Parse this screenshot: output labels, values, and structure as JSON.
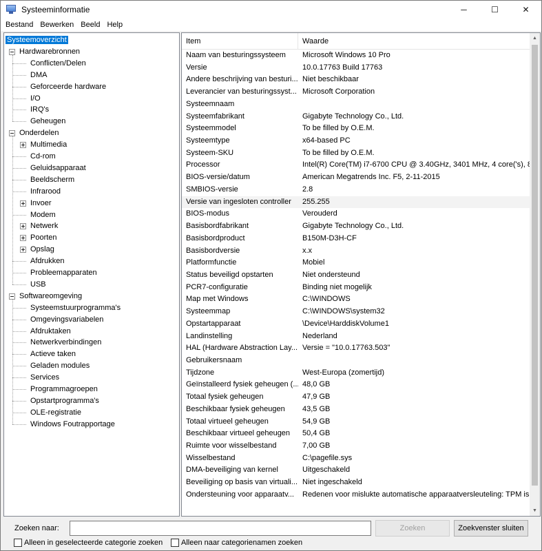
{
  "window": {
    "title": "Systeeminformatie",
    "controls": [
      "─",
      "☐",
      "✕"
    ]
  },
  "menu": [
    "Bestand",
    "Bewerken",
    "Beeld",
    "Help"
  ],
  "tree": [
    {
      "label": "Systeemoverzicht",
      "level": 0,
      "expander": "none",
      "selected": true
    },
    {
      "label": "Hardwarebronnen",
      "level": 0,
      "expander": "minus"
    },
    {
      "label": "Conflicten/Delen",
      "level": 1,
      "expander": "none"
    },
    {
      "label": "DMA",
      "level": 1,
      "expander": "none"
    },
    {
      "label": "Geforceerde hardware",
      "level": 1,
      "expander": "none"
    },
    {
      "label": "I/O",
      "level": 1,
      "expander": "none"
    },
    {
      "label": "IRQ's",
      "level": 1,
      "expander": "none"
    },
    {
      "label": "Geheugen",
      "level": 1,
      "expander": "none"
    },
    {
      "label": "Onderdelen",
      "level": 0,
      "expander": "minus"
    },
    {
      "label": "Multimedia",
      "level": 1,
      "expander": "plus"
    },
    {
      "label": "Cd-rom",
      "level": 1,
      "expander": "none"
    },
    {
      "label": "Geluidsapparaat",
      "level": 1,
      "expander": "none"
    },
    {
      "label": "Beeldscherm",
      "level": 1,
      "expander": "none"
    },
    {
      "label": "Infrarood",
      "level": 1,
      "expander": "none"
    },
    {
      "label": "Invoer",
      "level": 1,
      "expander": "plus"
    },
    {
      "label": "Modem",
      "level": 1,
      "expander": "none"
    },
    {
      "label": "Netwerk",
      "level": 1,
      "expander": "plus"
    },
    {
      "label": "Poorten",
      "level": 1,
      "expander": "plus"
    },
    {
      "label": "Opslag",
      "level": 1,
      "expander": "plus"
    },
    {
      "label": "Afdrukken",
      "level": 1,
      "expander": "none"
    },
    {
      "label": "Probleemapparaten",
      "level": 1,
      "expander": "none"
    },
    {
      "label": "USB",
      "level": 1,
      "expander": "none"
    },
    {
      "label": "Softwareomgeving",
      "level": 0,
      "expander": "minus"
    },
    {
      "label": "Systeemstuurprogramma's",
      "level": 1,
      "expander": "none"
    },
    {
      "label": "Omgevingsvariabelen",
      "level": 1,
      "expander": "none"
    },
    {
      "label": "Afdruktaken",
      "level": 1,
      "expander": "none"
    },
    {
      "label": "Netwerkverbindingen",
      "level": 1,
      "expander": "none"
    },
    {
      "label": "Actieve taken",
      "level": 1,
      "expander": "none"
    },
    {
      "label": "Geladen modules",
      "level": 1,
      "expander": "none"
    },
    {
      "label": "Services",
      "level": 1,
      "expander": "none"
    },
    {
      "label": "Programmagroepen",
      "level": 1,
      "expander": "none"
    },
    {
      "label": "Opstartprogramma's",
      "level": 1,
      "expander": "none"
    },
    {
      "label": "OLE-registratie",
      "level": 1,
      "expander": "none"
    },
    {
      "label": "Windows Foutrapportage",
      "level": 1,
      "expander": "none"
    }
  ],
  "list": {
    "columns": [
      "Item",
      "Waarde"
    ],
    "rows": [
      [
        "Naam van besturingssysteem",
        "Microsoft Windows 10 Pro"
      ],
      [
        "Versie",
        "10.0.17763 Build 17763"
      ],
      [
        "Andere beschrijving van besturi...",
        "Niet beschikbaar"
      ],
      [
        "Leverancier van besturingssyst...",
        "Microsoft Corporation"
      ],
      [
        "Systeemnaam",
        ""
      ],
      [
        "Systeemfabrikant",
        "Gigabyte Technology Co., Ltd."
      ],
      [
        "Systeemmodel",
        "To be filled by O.E.M."
      ],
      [
        "Systeemtype",
        "x64-based PC"
      ],
      [
        "Systeem-SKU",
        "To be filled by O.E.M."
      ],
      [
        "Processor",
        "Intel(R) Core(TM) i7-6700 CPU @ 3.40GHz, 3401 MHz, 4 core('s), 8 l"
      ],
      [
        "BIOS-versie/datum",
        "American Megatrends Inc. F5, 2-11-2015"
      ],
      [
        "SMBIOS-versie",
        "2.8"
      ],
      [
        "Versie van ingesloten controller",
        "255.255"
      ],
      [
        "BIOS-modus",
        "Verouderd"
      ],
      [
        "Basisbordfabrikant",
        "Gigabyte Technology Co., Ltd."
      ],
      [
        "Basisbordproduct",
        "B150M-D3H-CF"
      ],
      [
        "Basisbordversie",
        "x.x"
      ],
      [
        "Platformfunctie",
        "Mobiel"
      ],
      [
        "Status beveiligd opstarten",
        "Niet ondersteund"
      ],
      [
        "PCR7-configuratie",
        "Binding niet mogelijk"
      ],
      [
        "Map met Windows",
        "C:\\WINDOWS"
      ],
      [
        "Systeemmap",
        "C:\\WINDOWS\\system32"
      ],
      [
        "Opstartapparaat",
        "\\Device\\HarddiskVolume1"
      ],
      [
        "Landinstelling",
        "Nederland"
      ],
      [
        "HAL (Hardware Abstraction Lay...",
        "Versie = \"10.0.17763.503\""
      ],
      [
        "Gebruikersnaam",
        ""
      ],
      [
        "Tijdzone",
        "West-Europa (zomertijd)"
      ],
      [
        "Geïnstalleerd fysiek geheugen (...",
        "48,0 GB"
      ],
      [
        "Totaal fysiek geheugen",
        "47,9 GB"
      ],
      [
        "Beschikbaar fysiek geheugen",
        "43,5 GB"
      ],
      [
        "Totaal virtueel geheugen",
        "54,9 GB"
      ],
      [
        "Beschikbaar virtueel geheugen",
        "50,4 GB"
      ],
      [
        "Ruimte voor wisselbestand",
        "7,00 GB"
      ],
      [
        "Wisselbestand",
        "C:\\pagefile.sys"
      ],
      [
        "DMA-beveiliging van kernel",
        "Uitgeschakeld"
      ],
      [
        "Beveiliging op basis van virtuali...",
        "Niet ingeschakeld"
      ],
      [
        "Ondersteuning voor apparaatv...",
        "Redenen voor mislukte automatische apparaatversleuteling: TPM is"
      ]
    ],
    "hover_row": 12
  },
  "search": {
    "label": "Zoeken naar:",
    "value": "",
    "find_button": "Zoeken",
    "close_button": "Zoekvenster sluiten",
    "checkbox_selected_category": "Alleen in geselecteerde categorie zoeken",
    "checkbox_category_names": "Alleen naar categorienamen zoeken"
  },
  "colors": {
    "selection": "#0078d7",
    "pane_border": "#828790"
  }
}
